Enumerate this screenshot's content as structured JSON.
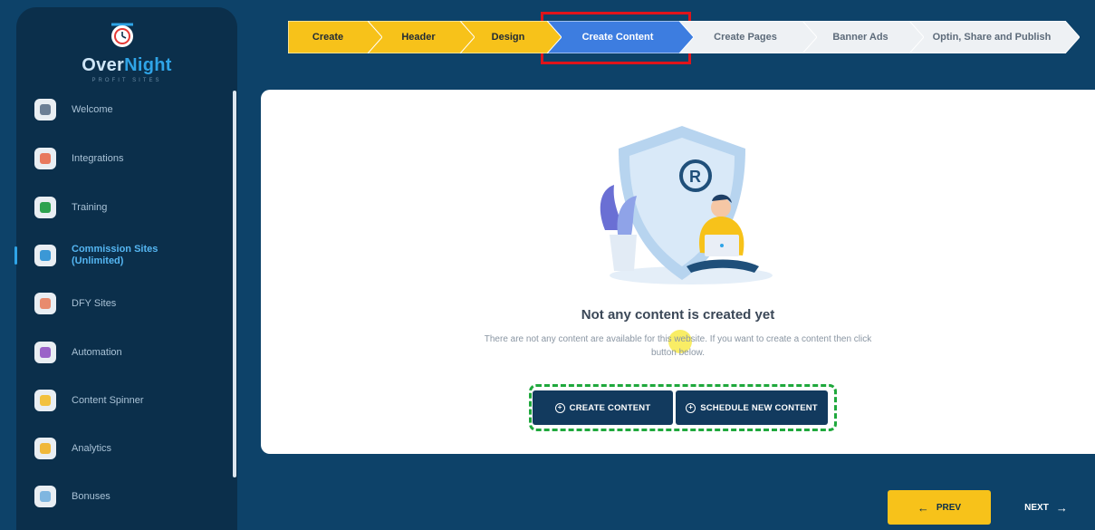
{
  "brand": {
    "name_part1": "Over",
    "name_part2": "Night",
    "tagline": "PROFIT SITES"
  },
  "sidebar": {
    "items": [
      {
        "label": "Welcome",
        "icon": "welcome-icon",
        "color": "#6c7f95"
      },
      {
        "label": "Integrations",
        "icon": "integrations-icon",
        "color": "#e8795e"
      },
      {
        "label": "Training",
        "icon": "training-icon",
        "color": "#2ca24f"
      },
      {
        "label": "Commission Sites (Unlimited)",
        "icon": "commission-icon",
        "color": "#3b98d6",
        "active": true
      },
      {
        "label": "DFY Sites",
        "icon": "dfy-icon",
        "color": "#e88b6e"
      },
      {
        "label": "Automation",
        "icon": "automation-icon",
        "color": "#9a62c8"
      },
      {
        "label": "Content Spinner",
        "icon": "spinner-icon",
        "color": "#f2c13e"
      },
      {
        "label": "Analytics",
        "icon": "analytics-icon",
        "color": "#f0b83a"
      },
      {
        "label": "Bonuses",
        "icon": "bonuses-icon",
        "color": "#7fb6e0"
      }
    ]
  },
  "steps": [
    {
      "label": "Create",
      "state": "done"
    },
    {
      "label": "Header",
      "state": "done"
    },
    {
      "label": "Design",
      "state": "done"
    },
    {
      "label": "Create Content",
      "state": "current"
    },
    {
      "label": "Create Pages",
      "state": "todo"
    },
    {
      "label": "Banner Ads",
      "state": "todo"
    },
    {
      "label": "Optin, Share and Publish",
      "state": "todo"
    }
  ],
  "main": {
    "empty_title": "Not any content is created yet",
    "empty_desc": "There are not any content are available for this website. If you want to create a content then click button below.",
    "create_button": "CREATE CONTENT",
    "schedule_button": "SCHEDULE NEW CONTENT"
  },
  "footer": {
    "prev_label": "PREV",
    "next_label": "NEXT"
  },
  "colors": {
    "background": "#0d4269",
    "sidebar": "#0b2f4b",
    "step_done": "#f7c21a",
    "step_current": "#3d7de0",
    "step_todo": "#eef1f4",
    "primary_button": "#123a5e"
  }
}
